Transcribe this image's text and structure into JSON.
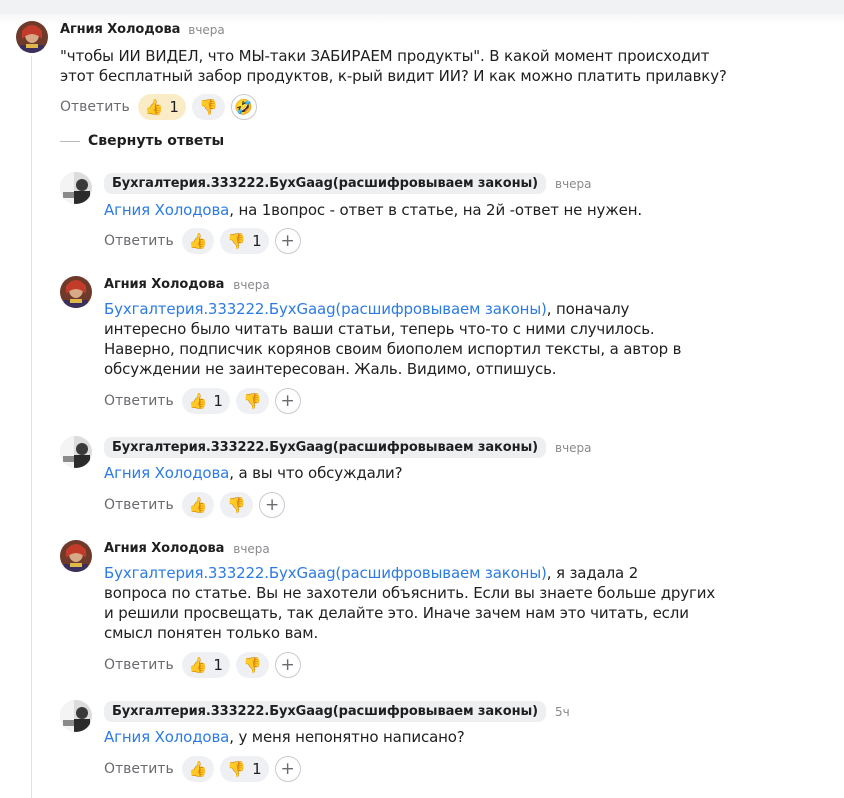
{
  "ui": {
    "reply_label": "Ответить",
    "collapse_label": "Свернуть ответы"
  },
  "colors": {
    "mention": "#2c7be5",
    "pill_bg": "#eef0f3",
    "author_chip_bg": "#eeeff1"
  },
  "icons": {
    "like": "👍",
    "dislike": "👎",
    "laugh": "🤣",
    "plus": "+"
  },
  "top_comment": {
    "author": "Агния Холодова",
    "time": "вчера",
    "lines": [
      "\"чтобы ИИ ВИДЕЛ, что МЫ-таки ЗАБИРАЕМ продукты\". В какой момент происходит",
      "этот бесплатный забор продуктов, к-рый видит ИИ? И как можно платить прилавку?"
    ],
    "likes": "1"
  },
  "replies": [
    {
      "author": "Бухгалтерия.333222.БухGaag(расшифровываем законы)",
      "time": "вчера",
      "mention": "Агния Холодова",
      "lines": [
        ", на 1вопрос - ответ в статье, на 2й -ответ не нужен."
      ],
      "likes": "",
      "dislikes": "1"
    },
    {
      "author": "Агния Холодова",
      "time": "вчера",
      "mention": "Бухгалтерия.333222.БухGaag(расшифровываем законы)",
      "lines": [
        ", поначалу",
        "интересно было читать ваши статьи, теперь что-то с ними случилось.",
        "Наверно, подписчик корянов своим биополем испортил тексты, а автор в",
        "обсуждении не заинтересован. Жаль. Видимо, отпишусь."
      ],
      "likes": "1",
      "dislikes": ""
    },
    {
      "author": "Бухгалтерия.333222.БухGaag(расшифровываем законы)",
      "time": "вчера",
      "mention": "Агния Холодова",
      "lines": [
        ", а вы что обсуждали?"
      ],
      "likes": "",
      "dislikes": ""
    },
    {
      "author": "Агния Холодова",
      "time": "вчера",
      "mention": "Бухгалтерия.333222.БухGaag(расшифровываем законы)",
      "lines": [
        ", я задала 2",
        "вопроса по статье. Вы не захотели объяснить. Если вы знаете больше других",
        "и решили просвещать, так делайте это. Иначе зачем нам это читать, если",
        "смысл понятен только вам."
      ],
      "likes": "1",
      "dislikes": ""
    },
    {
      "author": "Бухгалтерия.333222.БухGaag(расшифровываем законы)",
      "time": "5ч",
      "mention": "Агния Холодова",
      "lines": [
        ", у меня непонятно написано?"
      ],
      "likes": "",
      "dislikes": "1"
    }
  ]
}
